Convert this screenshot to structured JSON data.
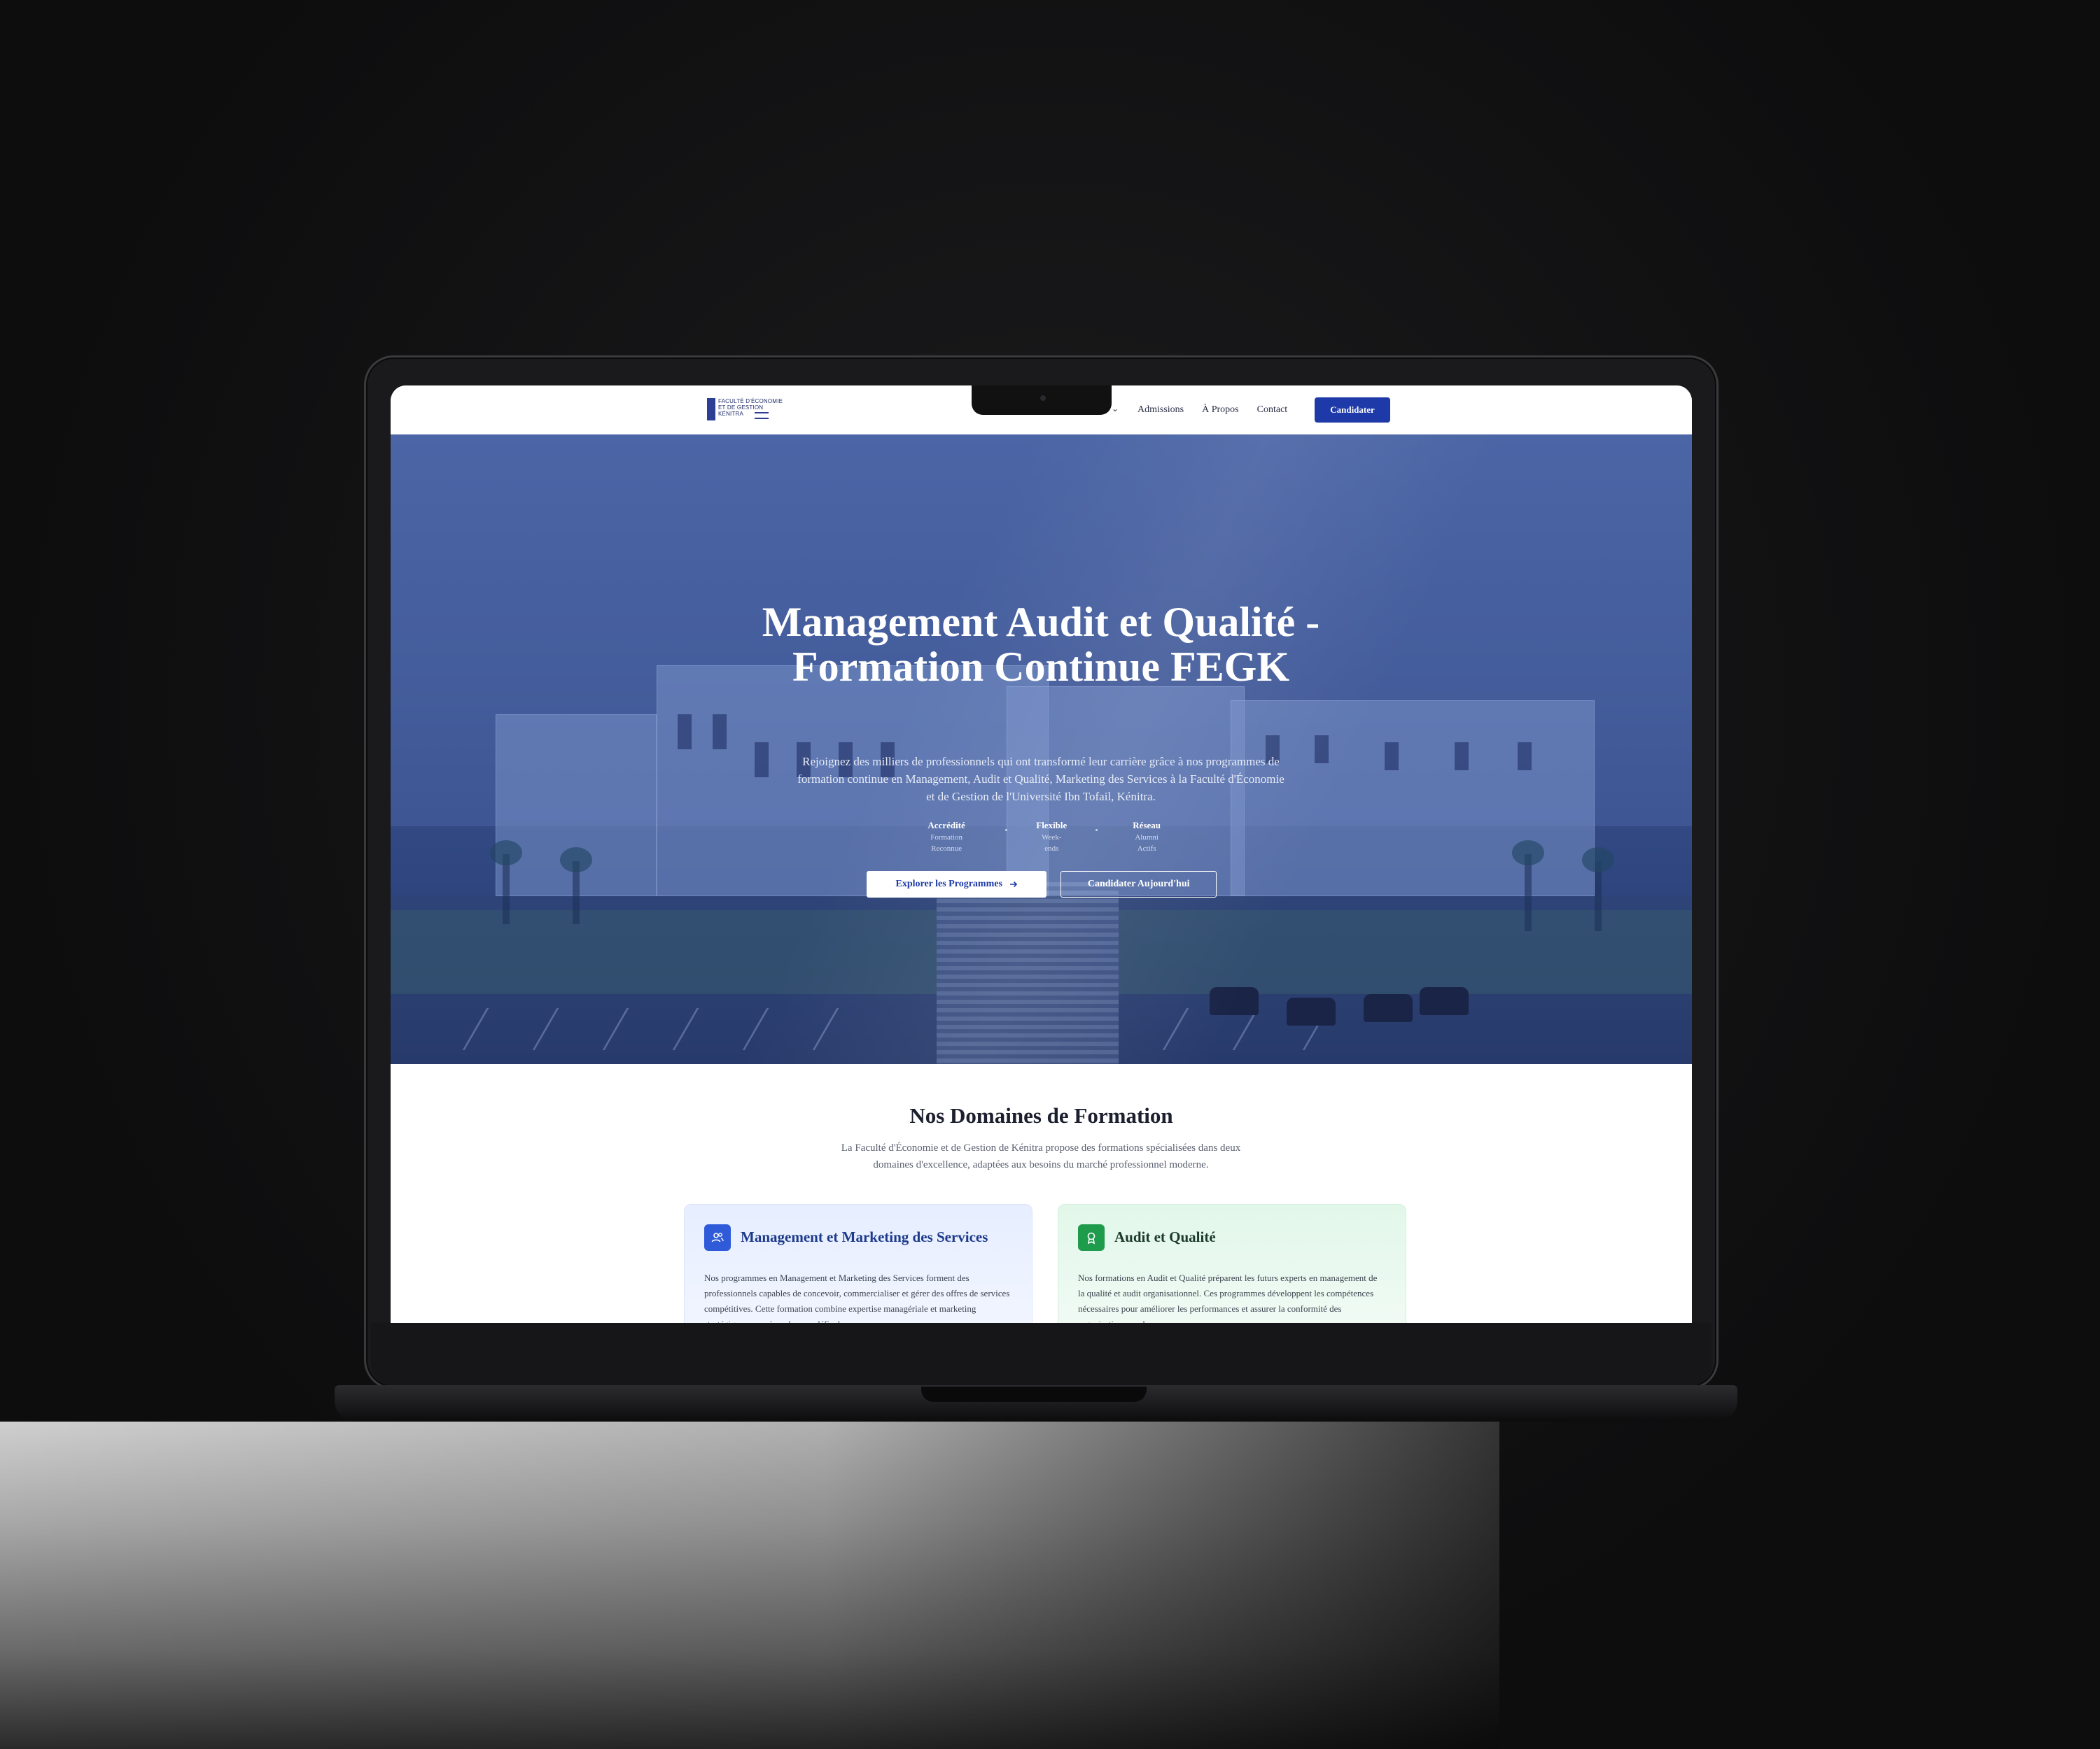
{
  "nav": {
    "logo_text": "FACULTÉ D'ÉCONOMIE\nET DE GESTION\nKÉNITRA",
    "links": [
      "Admissions",
      "À Propos",
      "Contact"
    ],
    "dropdown_chevron": "⌄",
    "cta": "Candidater"
  },
  "hero": {
    "title": "Management Audit et Qualité - Formation Continue FEGK",
    "subtitle": "Rejoignez des milliers de professionnels qui ont transformé leur carrière grâce à nos programmes de formation continue en Management, Audit et Qualité, Marketing des Services à la Faculté d'Économie et de Gestion de l'Université Ibn Tofail, Kénitra.",
    "stats": [
      {
        "value": "Accrédité",
        "label": "Formation Reconnue"
      },
      {
        "value": "Flexible",
        "label": "Week-ends"
      },
      {
        "value": "Réseau",
        "label": "Alumni Actifs"
      }
    ],
    "primary_button": "Explorer les Programmes",
    "primary_button_icon": "arrow-right-icon",
    "secondary_button": "Candidater Aujourd'hui"
  },
  "domains": {
    "title": "Nos Domaines de Formation",
    "subtitle": "La Faculté d'Économie et de Gestion de Kénitra propose des formations spécialisées dans deux domaines d'excellence, adaptées aux besoins du marché professionnel moderne.",
    "cards": [
      {
        "title": "Management et Marketing des Services",
        "icon": "users-icon",
        "color": "#2f5bd8",
        "text": "Nos programmes en Management et Marketing des Services forment des professionnels capables de concevoir, commercialiser et gérer des offres de services compétitives. Cette formation combine expertise managériale et marketing stratégique pour répondre aux défis du"
      },
      {
        "title": "Audit et Qualité",
        "icon": "award-icon",
        "color": "#1f9b4c",
        "text": "Nos formations en Audit et Qualité préparent les futurs experts en management de la qualité et audit organisationnel. Ces programmes développent les compétences nécessaires pour améliorer les performances et assurer la conformité des organisations modernes."
      }
    ]
  },
  "colors": {
    "brand": "#1e3aa8",
    "hero_overlay": "#2f4a8f"
  }
}
